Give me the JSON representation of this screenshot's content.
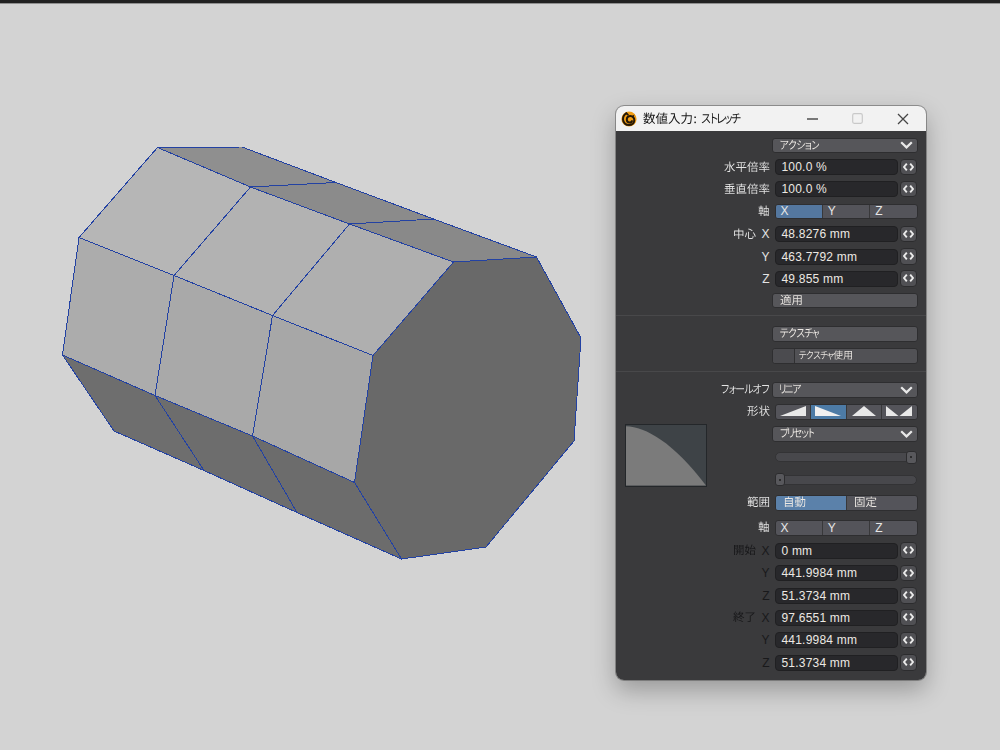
{
  "viewport": {
    "object": "octagonal cylinder mesh, 3 segments, shaded with blue wireframe",
    "background": "#d3d3d3",
    "edge_color": "#2644a6"
  },
  "window": {
    "title": "数値入力: ストレッチ"
  },
  "panel": {
    "action": {
      "value": "アクション"
    },
    "horizontal_ratio": {
      "label": "水平倍率",
      "value": "100.0 %"
    },
    "vertical_ratio": {
      "label": "垂直倍率",
      "value": "100.0 %"
    },
    "axis": {
      "label": "軸",
      "options": [
        "X",
        "Y",
        "Z"
      ],
      "selected": "X"
    },
    "center": {
      "label": "中心",
      "x_label": "X",
      "y_label": "Y",
      "z_label": "Z",
      "x": "48.8276 mm",
      "y": "463.7792 mm",
      "z": "49.855 mm"
    },
    "apply": {
      "label": "適用"
    },
    "texture": {
      "label": "テクスチャ"
    },
    "texture_use": {
      "label": "テクスチャ使用",
      "checked": false
    },
    "falloff": {
      "label": "フォールオフ",
      "value": "リニア"
    },
    "shape": {
      "label": "形状",
      "options": [
        "ramp-up",
        "ramp-down",
        "peak",
        "valley"
      ],
      "selected": "ramp-down"
    },
    "preset": {
      "value": "プリセット"
    },
    "slider_top": {
      "position": 1.0
    },
    "slider_bottom": {
      "position": 0.0
    },
    "range": {
      "label": "範囲",
      "options": [
        "自動",
        "固定"
      ],
      "selected": "自動"
    },
    "axis2": {
      "label": "軸",
      "options": [
        "X",
        "Y",
        "Z"
      ],
      "selected": null
    },
    "start": {
      "label": "開始",
      "x_label": "X",
      "y_label": "Y",
      "z_label": "Z",
      "x": "0 mm",
      "y": "441.9984 mm",
      "z": "51.3734 mm"
    },
    "end": {
      "label": "終了",
      "x_label": "X",
      "y_label": "Y",
      "z_label": "Z",
      "x": "97.6551 mm",
      "y": "441.9984 mm",
      "z": "51.3734 mm"
    }
  }
}
